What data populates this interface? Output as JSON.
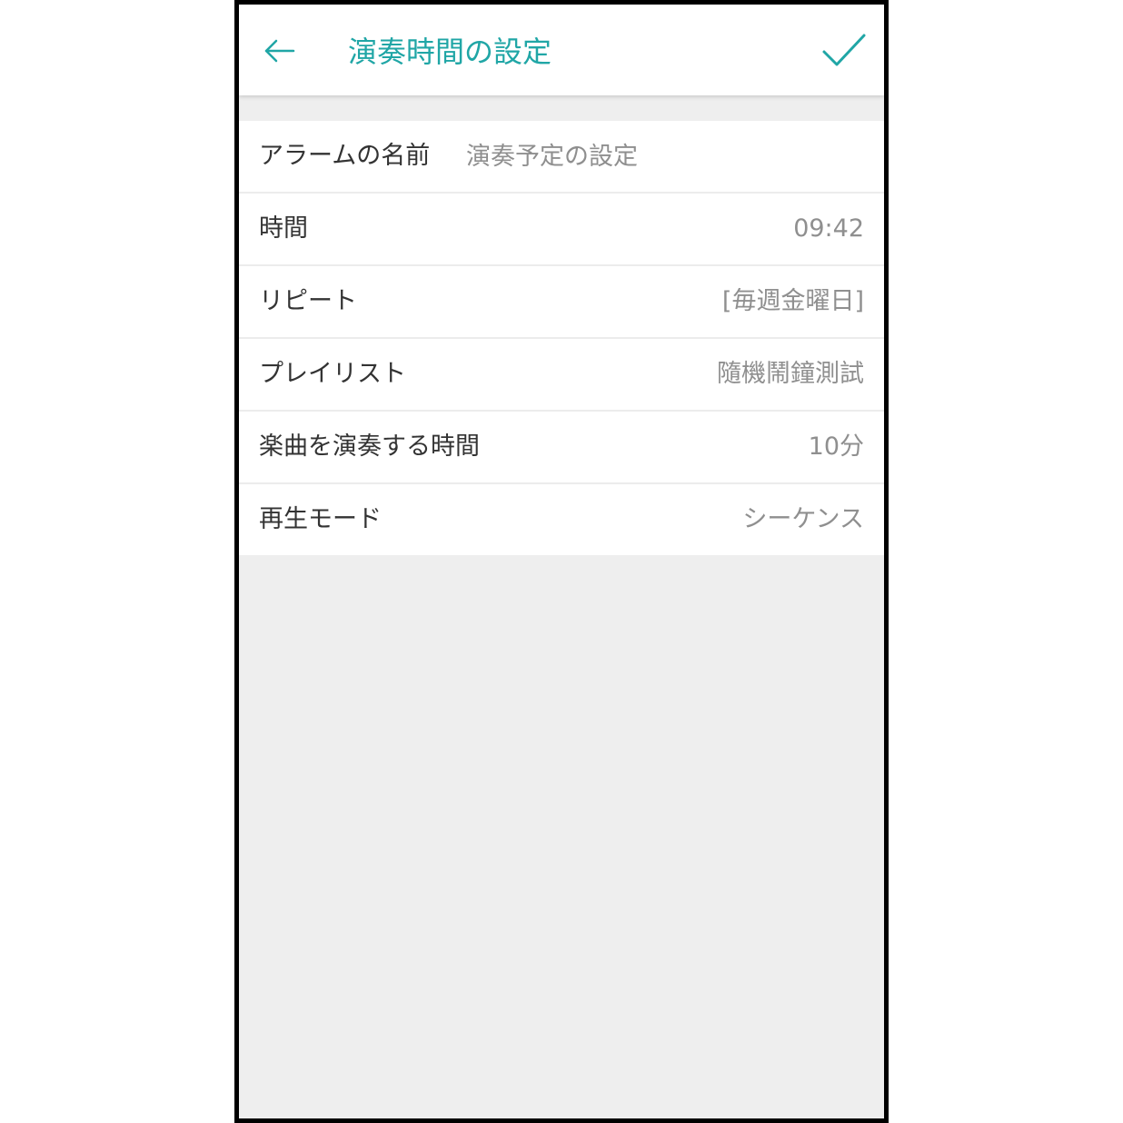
{
  "colors": {
    "accent": "#20a6a6",
    "background": "#eeeeee",
    "surface": "#ffffff",
    "divider": "#ececec",
    "label": "#333333",
    "value": "#8f8f8f"
  },
  "appbar": {
    "back_icon": "arrow-left-icon",
    "title": "演奏時間の設定",
    "confirm_icon": "checkmark-icon"
  },
  "settings": {
    "alarm_name": {
      "label": "アラームの名前",
      "value": "演奏予定の設定"
    },
    "time": {
      "label": "時間",
      "value": "09:42"
    },
    "repeat": {
      "label": "リピート",
      "value": "[毎週金曜日]"
    },
    "playlist": {
      "label": "プレイリスト",
      "value": "隨機鬧鐘測試"
    },
    "play_duration": {
      "label": "楽曲を演奏する時間",
      "value": "10分"
    },
    "play_mode": {
      "label": "再生モード",
      "value": "シーケンス"
    }
  }
}
